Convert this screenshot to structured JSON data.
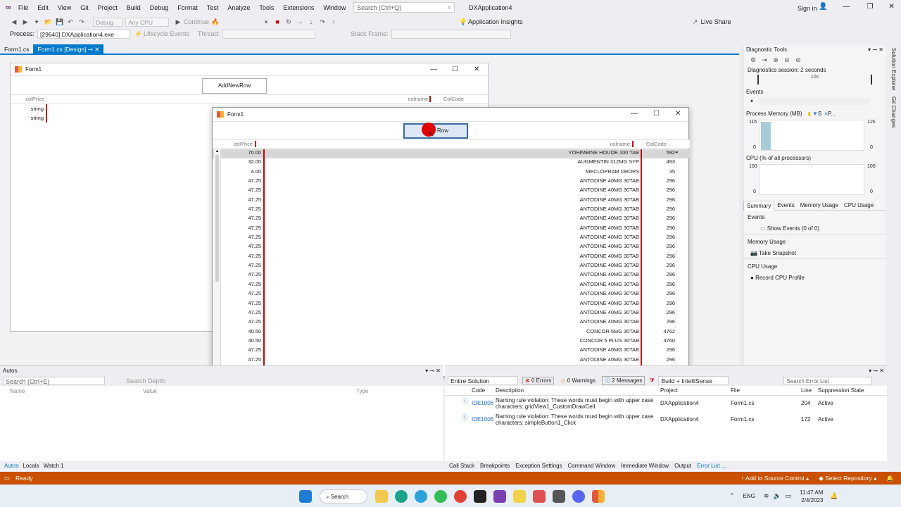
{
  "menu": {
    "items": [
      "File",
      "Edit",
      "View",
      "Git",
      "Project",
      "Build",
      "Debug",
      "Format",
      "Test",
      "Analyze",
      "Tools",
      "Extensions",
      "Window",
      "Help"
    ],
    "search_placeholder": "Search (Ctrl+Q)",
    "app_title": "DXApplication4",
    "sign_in": "Sign in"
  },
  "toolbar": {
    "config": "Debug",
    "platform": "Any CPU",
    "continue": "Continue",
    "app_insights": "Application Insights",
    "live_share": "Live Share"
  },
  "toolbar2": {
    "process_label": "Process:",
    "process": "[29640] DXApplication4.exe",
    "lifecycle": "Lifecycle Events",
    "thread_label": "Thread:",
    "stack_label": "Stack Frame:"
  },
  "tabs": [
    "Form1.cs",
    "Form1.cs [Design]"
  ],
  "design_form": {
    "title": "Form1",
    "button": "AddNewRow",
    "headers": [
      "colPrice",
      "colname",
      "ColCode"
    ],
    "rows": [
      "string",
      "string"
    ]
  },
  "run_form": {
    "title": "Form1",
    "button": "AddNewRow",
    "button_visible": "Row",
    "headers": [
      "colPrice",
      "colname",
      "ColCode"
    ],
    "rows": [
      [
        "70.00",
        "YOHIMBINE HOUDE 100 TAB",
        "592"
      ],
      [
        "32.00",
        "AUGMENTIN 312MG SYP",
        "493"
      ],
      [
        "4.00",
        "MECLOPRAM DROPS",
        "35"
      ],
      [
        "47.25",
        "ANTODINE 40MG 30TAB",
        "296"
      ],
      [
        "47.25",
        "ANTODINE 40MG 30TAB",
        "296"
      ],
      [
        "47.25",
        "ANTODINE 40MG 30TAB",
        "296"
      ],
      [
        "47.25",
        "ANTODINE 40MG 30TAB",
        "296"
      ],
      [
        "47.25",
        "ANTODINE 40MG 30TAB",
        "296"
      ],
      [
        "47.25",
        "ANTODINE 40MG 30TAB",
        "296"
      ],
      [
        "47.25",
        "ANTODINE 40MG 30TAB",
        "296"
      ],
      [
        "47.25",
        "ANTODINE 40MG 30TAB",
        "296"
      ],
      [
        "47.25",
        "ANTODINE 40MG 30TAB",
        "296"
      ],
      [
        "47.25",
        "ANTODINE 40MG 30TAB",
        "296"
      ],
      [
        "47.25",
        "ANTODINE 40MG 30TAB",
        "296"
      ],
      [
        "47.25",
        "ANTODINE 40MG 30TAB",
        "296"
      ],
      [
        "47.25",
        "ANTODINE 40MG 30TAB",
        "296"
      ],
      [
        "47.25",
        "ANTODINE 40MG 30TAB",
        "296"
      ],
      [
        "47.25",
        "ANTODINE 40MG 30TAB",
        "296"
      ],
      [
        "47.25",
        "ANTODINE 40MG 30TAB",
        "296"
      ],
      [
        "40.50",
        "CONCOR 5MG 30TAB",
        "4762"
      ],
      [
        "40.50",
        "CONCOR 5 PLUS 30TAB",
        "4760"
      ],
      [
        "47.25",
        "ANTODINE 40MG 30TAB",
        "296"
      ],
      [
        "47.25",
        "ANTODINE 40MG 30TAB",
        "296"
      ]
    ]
  },
  "diag": {
    "title": "Diagnostic Tools",
    "session": "Diagnostics session: 2 seconds",
    "tick": "10s",
    "events": "Events",
    "memory": "Process Memory (MB)",
    "mem_legend": [
      "S",
      "P..."
    ],
    "mem_max": "115",
    "mem_min": "0",
    "cpu": "CPU (% of all processors)",
    "cpu_max": "100",
    "cpu_min": "0",
    "tabs": [
      "Summary",
      "Events",
      "Memory Usage",
      "CPU Usage"
    ],
    "sections": [
      {
        "title": "Events",
        "action": "Show Events (0 of 0)"
      },
      {
        "title": "Memory Usage",
        "action": "Take Snapshot"
      },
      {
        "title": "CPU Usage",
        "action": "Record CPU Profile"
      }
    ]
  },
  "side": {
    "solution_explorer": "Solution Explorer",
    "git_changes": "Git Changes"
  },
  "autos": {
    "title": "Autos",
    "search": "Search (Ctrl+E)",
    "depth": "Search Depth:",
    "cols": [
      "Name",
      "Value",
      "Type"
    ],
    "tabs": [
      "Autos",
      "Locals",
      "Watch 1"
    ]
  },
  "errors": {
    "scope": "Entire Solution",
    "errors": "0 Errors",
    "warnings": "0 Warnings",
    "messages": "2 Messages",
    "build": "Build + IntelliSense",
    "search": "Search Error List",
    "cols": [
      "Code",
      "Description",
      "Project",
      "File",
      "Line",
      "Suppression State"
    ],
    "rows": [
      {
        "code": "IDE1006",
        "desc": "Naming rule violation: These words must begin with upper case characters: gridView1_CustomDrawCell",
        "project": "DXApplication4",
        "file": "Form1.cs",
        "line": "204",
        "state": "Active"
      },
      {
        "code": "IDE1006",
        "desc": "Naming rule violation: These words must begin with upper case characters: simpleButton1_Click",
        "project": "DXApplication4",
        "file": "Form1.cs",
        "line": "172",
        "state": "Active"
      }
    ],
    "tabs": [
      "Call Stack",
      "Breakpoints",
      "Exception Settings",
      "Command Window",
      "Immediate Window",
      "Output",
      "Error List ..."
    ]
  },
  "status": {
    "ready": "Ready",
    "source_control": "Add to Source Control",
    "repo": "Select Repository"
  },
  "taskbar": {
    "search": "Search",
    "lang": "ENG",
    "time": "11:47 AM",
    "date": "2/4/2023"
  },
  "colors": {
    "accent": "#007acc",
    "status": "#ca5100",
    "grid_line": "#cc0000"
  }
}
